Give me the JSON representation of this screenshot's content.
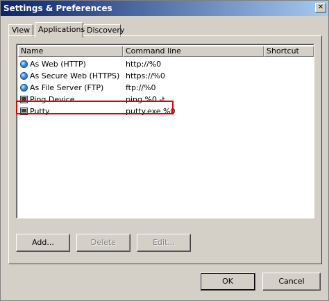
{
  "window": {
    "title": "Settings & Preferences",
    "close_glyph": "✕"
  },
  "tabs": [
    {
      "label": "View"
    },
    {
      "label": "Applications"
    },
    {
      "label": "Discovery"
    }
  ],
  "table": {
    "columns": [
      "Name",
      "Command line",
      "Shortcut"
    ],
    "rows": [
      {
        "icon": "globe-icon",
        "name": "As Web (HTTP)",
        "command": "http://%0",
        "shortcut": ""
      },
      {
        "icon": "globe-icon",
        "name": "As Secure Web (HTTPS)",
        "command": "https://%0",
        "shortcut": ""
      },
      {
        "icon": "globe-icon",
        "name": "As File Server (FTP)",
        "command": "ftp://%0",
        "shortcut": ""
      },
      {
        "icon": "monitor-icon",
        "name": "Ping Device",
        "command": "ping %0 -t",
        "shortcut": ""
      },
      {
        "icon": "monitor-icon",
        "name": "Putty",
        "command": "putty.exe %0",
        "shortcut": ""
      }
    ]
  },
  "actions": {
    "add": "Add...",
    "delete": "Delete",
    "edit": "Edit..."
  },
  "dialog": {
    "ok": "OK",
    "cancel": "Cancel"
  },
  "colors": {
    "highlight_border": "#e00000",
    "title_gradient_start": "#0a246a"
  }
}
